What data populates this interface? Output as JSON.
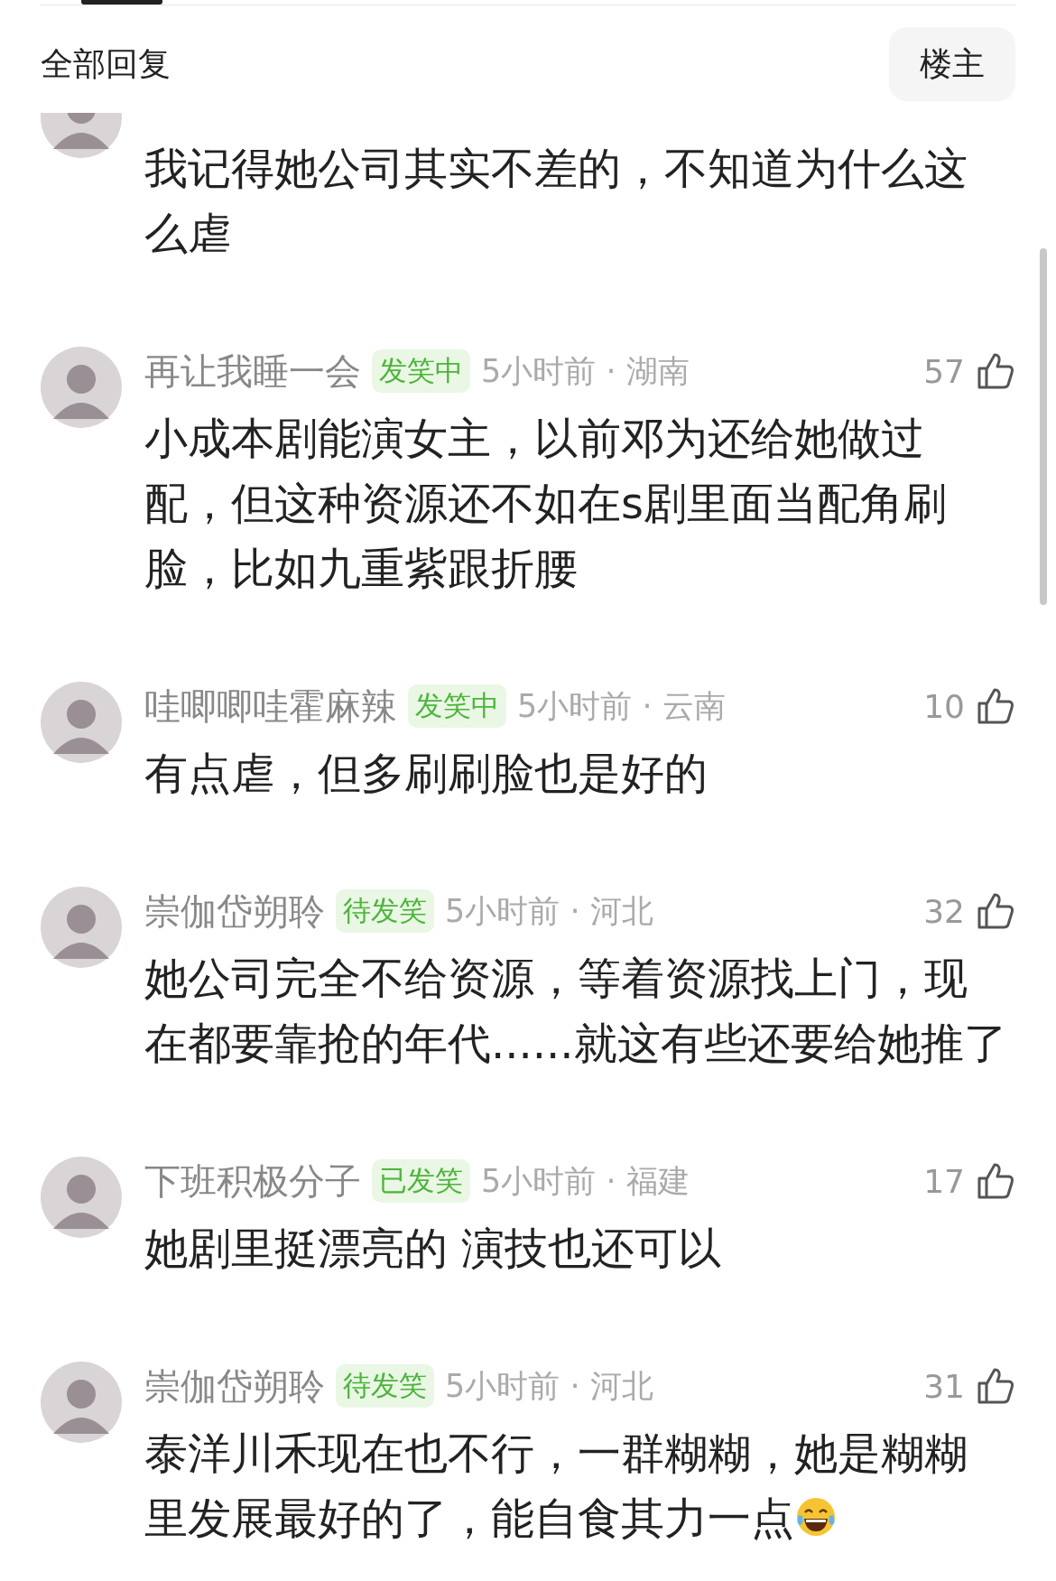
{
  "header": {
    "title": "全部回复",
    "filter_button": "楼主"
  },
  "comments": [
    {
      "text": "我记得她公司其实不差的，不知道为什么这么虐"
    },
    {
      "author": "再让我睡一会",
      "badge": "发笑中",
      "time": "5小时前 · 湖南",
      "likes": "57",
      "text": "小成本剧能演女主，以前邓为还给她做过配，但这种资源还不如在s剧里面当配角刷脸，比如九重紫跟折腰"
    },
    {
      "author": "哇唧唧哇霍麻辣",
      "badge": "发笑中",
      "time": "5小时前 · 云南",
      "likes": "10",
      "text": "有点虐，但多刷刷脸也是好的"
    },
    {
      "author": "崇伽岱朔聆",
      "badge": "待发笑",
      "time": "5小时前 · 河北",
      "likes": "32",
      "text": "她公司完全不给资源，等着资源找上门，现在都要靠抢的年代......就这有些还要给她推了"
    },
    {
      "author": "下班积极分子",
      "badge": "已发笑",
      "time": "5小时前 · 福建",
      "likes": "17",
      "text": "她剧里挺漂亮的 演技也还可以"
    },
    {
      "author": "崇伽岱朔聆",
      "badge": "待发笑",
      "time": "5小时前 · 河北",
      "likes": "31",
      "text": "泰洋川禾现在也不行，一群糊糊，她是糊糊里发展最好的了，能自食其力一点",
      "trailing_emoji": {
        "kind": "laugh"
      }
    }
  ]
}
